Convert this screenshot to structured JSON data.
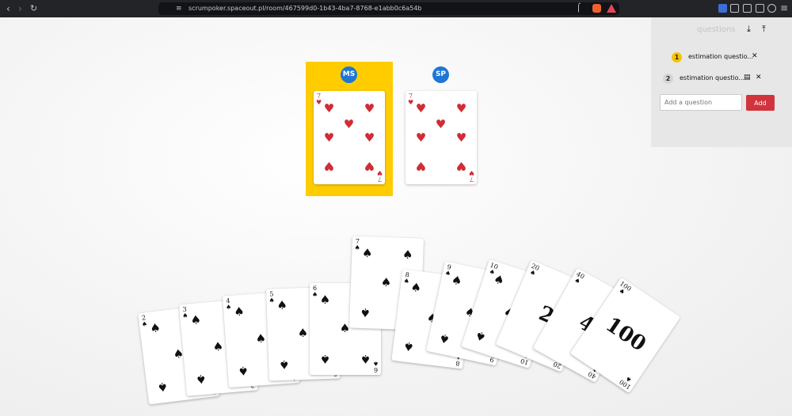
{
  "browser": {
    "back_icon": "arrow-left-icon",
    "forward_icon": "arrow-right-icon",
    "reload_icon": "reload-icon",
    "bookmark_icon": "bookmark-icon",
    "url": "scrumpoker.spaceout.pl/room/467599d0-1b43-4ba7-8768-e1abb0c6a54b",
    "share_icon": "share-icon",
    "menu_icon": "hamburger-menu-icon"
  },
  "players": [
    {
      "initials": "MS",
      "card": "7",
      "suit": "♥",
      "active": true,
      "avatar_color": "#1e76d6",
      "highlight_color": "#ffcc00"
    },
    {
      "initials": "SP",
      "card": "7",
      "suit": "♥",
      "active": false,
      "avatar_color": "#1e76d6"
    }
  ],
  "questions_panel": {
    "title": "questions",
    "download_icon": "download-icon",
    "upload_icon": "upload-icon",
    "items": [
      {
        "number": "1",
        "text": "estimation questio...",
        "badge_color": "#f5c400",
        "close": "✕"
      },
      {
        "number": "2",
        "text": "estimation questio...",
        "badge_color": "#d5d5d5",
        "book": "🕮",
        "close": "✕"
      }
    ],
    "input_placeholder": "Add a question",
    "add_label": "Add",
    "add_color": "#d1343d"
  },
  "hand": [
    {
      "value": "2",
      "suit": "♠"
    },
    {
      "value": "3",
      "suit": "♠"
    },
    {
      "value": "4",
      "suit": "♠"
    },
    {
      "value": "5",
      "suit": "♠"
    },
    {
      "value": "6",
      "suit": "♠"
    },
    {
      "value": "7",
      "suit": "♠"
    },
    {
      "value": "8",
      "suit": "♠"
    },
    {
      "value": "9",
      "suit": "♠"
    },
    {
      "value": "10",
      "suit": "♠"
    },
    {
      "value": "20",
      "suit": "♠",
      "big": "2"
    },
    {
      "value": "40",
      "suit": "♠",
      "big": "4"
    },
    {
      "value": "100",
      "suit": "♠",
      "big": "100"
    }
  ]
}
